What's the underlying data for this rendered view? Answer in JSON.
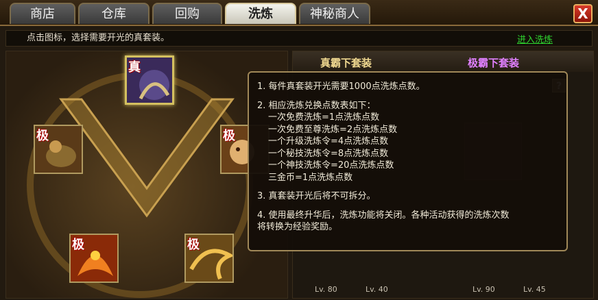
{
  "tabs": [
    {
      "label": "商店",
      "active": false
    },
    {
      "label": "仓库",
      "active": false
    },
    {
      "label": "回购",
      "active": false
    },
    {
      "label": "洗炼",
      "active": true
    },
    {
      "label": "神秘商人",
      "active": false
    }
  ],
  "close_label": "X",
  "hint_text": "点击图标，选择需要开光的真套装。",
  "enter_link": "进入洗炼",
  "left_panel": {
    "slots": [
      {
        "tag": "真",
        "icon": "dragon-icon",
        "selected": true
      },
      {
        "tag": "极",
        "icon": "armor-beast-icon",
        "selected": false
      },
      {
        "tag": "极",
        "icon": "tiger-icon",
        "selected": false
      },
      {
        "tag": "极",
        "icon": "phoenix-icon",
        "selected": false
      },
      {
        "tag": "极",
        "icon": "golden-dragon-icon",
        "selected": false
      }
    ]
  },
  "right_panel": {
    "set_normal": "真霸下套装",
    "set_ultimate": "极霸下套装",
    "help_label": "?",
    "levels": [
      "Lv. 80",
      "Lv. 40",
      "Lv. 90",
      "Lv. 45"
    ]
  },
  "tooltip": {
    "line1": "1. 每件真套装开光需要1000点洗炼点数。",
    "line2": "2. 相应洗炼兑换点数表如下：",
    "rates": [
      "一次免费洗炼=1点洗炼点数",
      "一次免费至尊洗炼=2点洗炼点数",
      "一个升级洗炼令=4点洗炼点数",
      "一个秘技洗炼令=8点洗炼点数",
      "一个神技洗炼令=20点洗炼点数",
      "三金币=1点洗炼点数"
    ],
    "line3": "3. 真套装开光后将不可拆分。",
    "line4a": "4. 使用最终升华后，洗炼功能将关闭。各种活动获得的洗炼次数",
    "line4b": "将转换为经验奖励。"
  },
  "colors": {
    "accent_gold": "#d4c060",
    "link_green": "#2fd42f",
    "ultimate_purple": "#e080ff",
    "close_red": "#d83a2a"
  }
}
